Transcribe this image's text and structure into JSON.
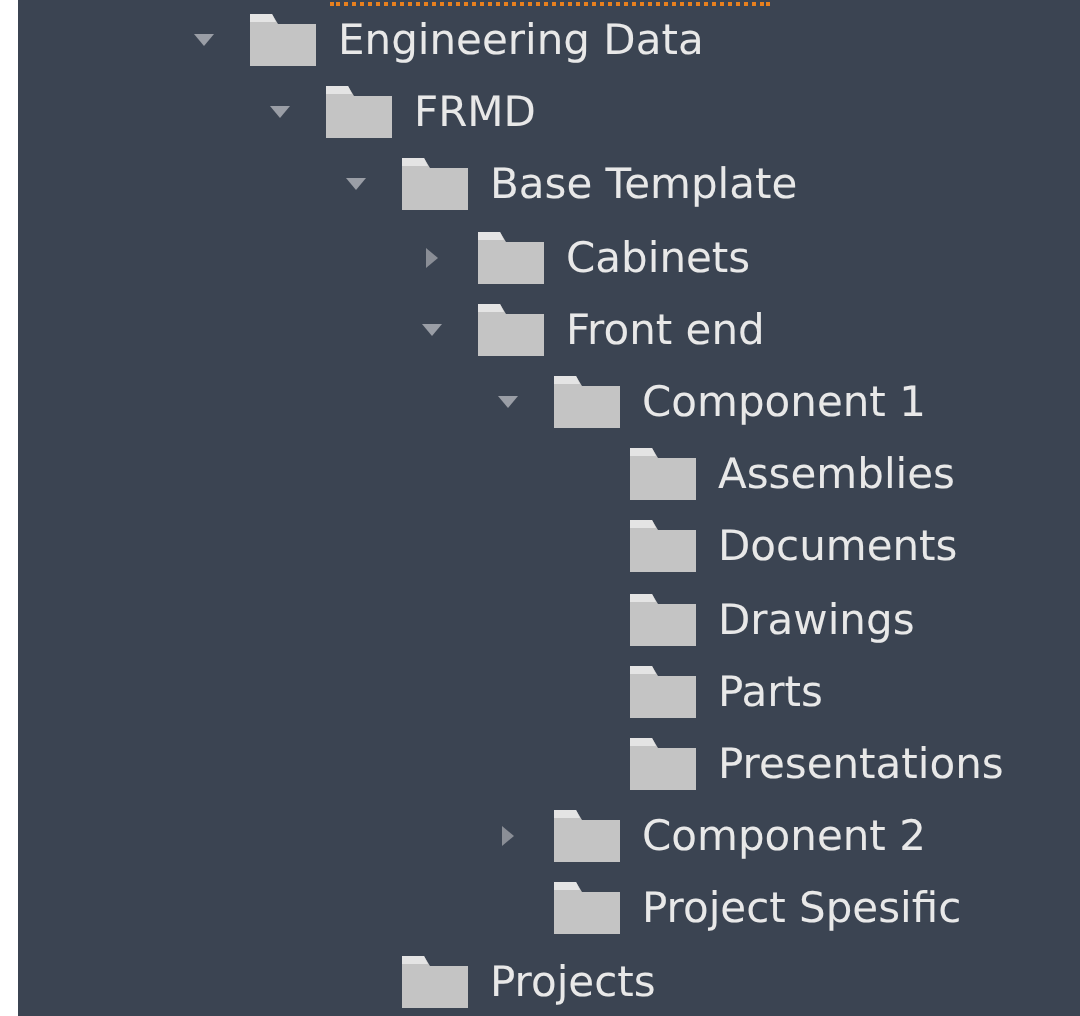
{
  "tree": [
    {
      "label": "Engineering Data",
      "expanded": true,
      "children": [
        {
          "label": "FRMD",
          "expanded": true,
          "children": [
            {
              "label": "Base Template",
              "expanded": true,
              "children": [
                {
                  "label": "Cabinets",
                  "expanded": false
                },
                {
                  "label": "Front end",
                  "expanded": true,
                  "children": [
                    {
                      "label": "Component 1",
                      "expanded": true,
                      "children": [
                        {
                          "label": "Assemblies"
                        },
                        {
                          "label": "Documents"
                        },
                        {
                          "label": "Drawings"
                        },
                        {
                          "label": "Parts"
                        },
                        {
                          "label": "Presentations"
                        }
                      ]
                    },
                    {
                      "label": "Component 2",
                      "expanded": false
                    },
                    {
                      "label": "Project Spesific"
                    }
                  ]
                }
              ]
            },
            {
              "label": "Projects"
            }
          ]
        }
      ]
    }
  ]
}
